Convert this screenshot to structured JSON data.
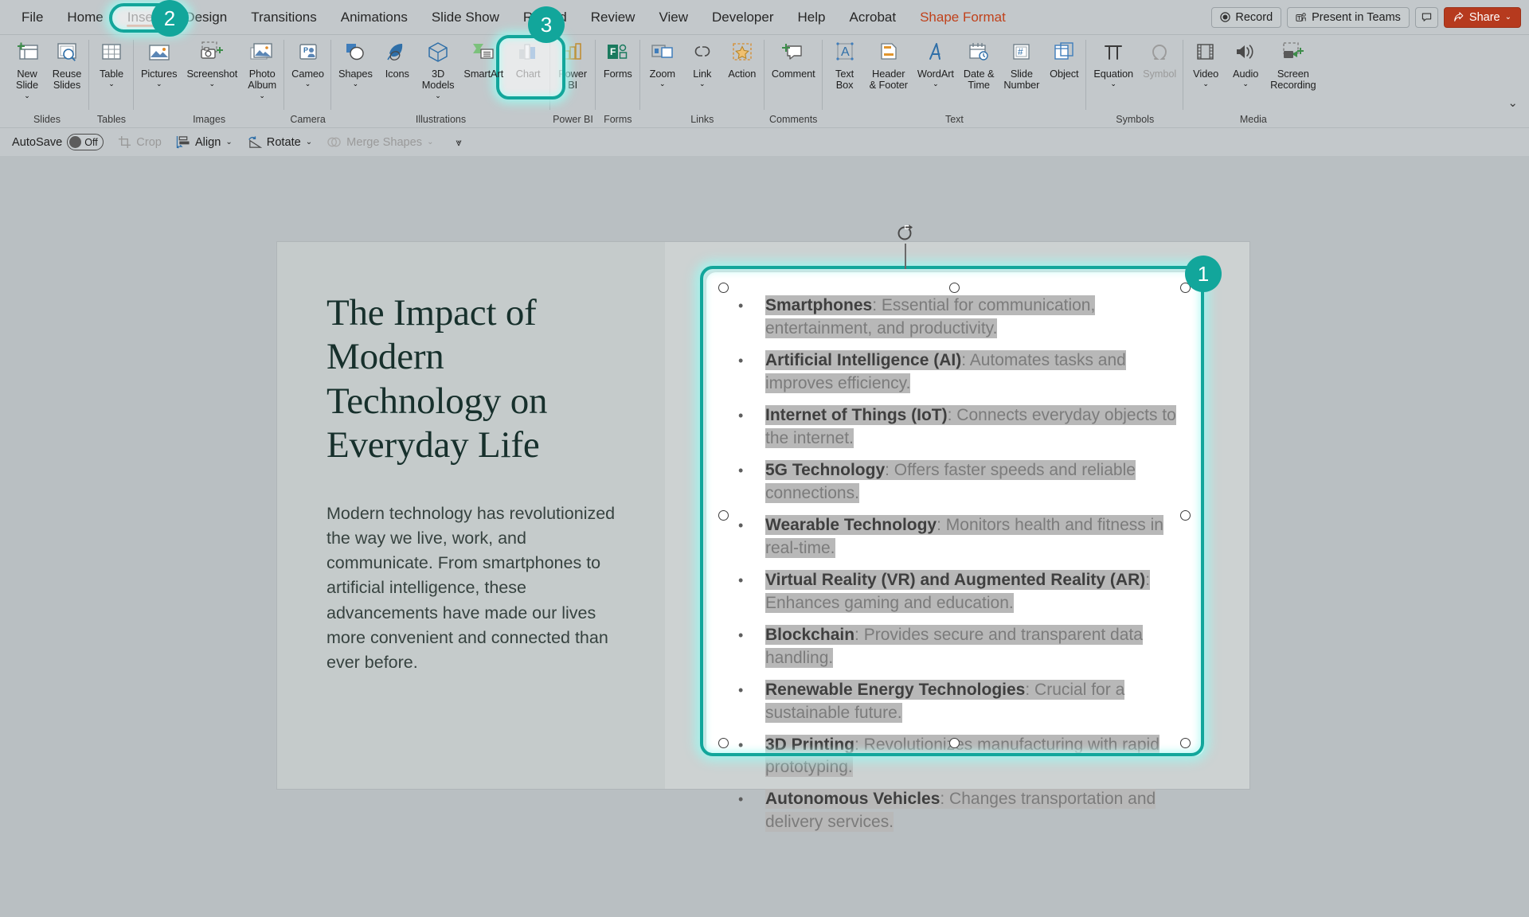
{
  "app": {
    "tabs": [
      {
        "id": "file",
        "label": "File"
      },
      {
        "id": "home",
        "label": "Home"
      },
      {
        "id": "insert",
        "label": "Insert",
        "active": true
      },
      {
        "id": "design",
        "label": "Design"
      },
      {
        "id": "transitions",
        "label": "Transitions"
      },
      {
        "id": "animations",
        "label": "Animations"
      },
      {
        "id": "slideshow",
        "label": "Slide Show"
      },
      {
        "id": "record",
        "label": "Record"
      },
      {
        "id": "review",
        "label": "Review"
      },
      {
        "id": "view",
        "label": "View"
      },
      {
        "id": "developer",
        "label": "Developer"
      },
      {
        "id": "help",
        "label": "Help"
      },
      {
        "id": "acrobat",
        "label": "Acrobat"
      },
      {
        "id": "shapeformat",
        "label": "Shape Format"
      }
    ],
    "titlebar_right": {
      "record": "Record",
      "present_in_teams": "Present in Teams",
      "comments_icon": "comment-icon",
      "share": "Share"
    }
  },
  "ribbon": {
    "groups": [
      {
        "name": "Slides",
        "label": "Slides",
        "buttons": [
          {
            "id": "new-slide",
            "label": "New\nSlide",
            "icon": "new-slide-icon",
            "caret": true
          },
          {
            "id": "reuse-slides",
            "label": "Reuse\nSlides",
            "icon": "reuse-slides-icon",
            "caret": false
          }
        ]
      },
      {
        "name": "Tables",
        "label": "Tables",
        "buttons": [
          {
            "id": "table",
            "label": "Table",
            "icon": "table-icon",
            "caret": true
          }
        ]
      },
      {
        "name": "Images",
        "label": "Images",
        "buttons": [
          {
            "id": "pictures",
            "label": "Pictures",
            "icon": "pictures-icon",
            "caret": true
          },
          {
            "id": "screenshot",
            "label": "Screenshot",
            "icon": "screenshot-icon",
            "caret": true
          },
          {
            "id": "photo-album",
            "label": "Photo\nAlbum",
            "icon": "photo-album-icon",
            "caret": true
          }
        ]
      },
      {
        "name": "Camera",
        "label": "Camera",
        "buttons": [
          {
            "id": "cameo",
            "label": "Cameo",
            "icon": "cameo-icon",
            "caret": true
          }
        ]
      },
      {
        "name": "Illustrations",
        "label": "Illustrations",
        "buttons": [
          {
            "id": "shapes",
            "label": "Shapes",
            "icon": "shapes-icon",
            "caret": true
          },
          {
            "id": "icons",
            "label": "Icons",
            "icon": "icons-icon",
            "caret": false
          },
          {
            "id": "3d-models",
            "label": "3D\nModels",
            "icon": "3d-models-icon",
            "caret": true
          },
          {
            "id": "smartart",
            "label": "SmartArt",
            "icon": "smartart-icon",
            "caret": false,
            "highlighted": true
          },
          {
            "id": "chart",
            "label": "Chart",
            "icon": "chart-icon",
            "caret": false
          }
        ]
      },
      {
        "name": "Power BI",
        "label": "Power BI",
        "buttons": [
          {
            "id": "power-bi",
            "label": "Power\nBI",
            "icon": "power-bi-icon",
            "caret": false
          }
        ]
      },
      {
        "name": "Forms",
        "label": "Forms",
        "buttons": [
          {
            "id": "forms",
            "label": "Forms",
            "icon": "forms-icon",
            "caret": false
          }
        ]
      },
      {
        "name": "Links",
        "label": "Links",
        "buttons": [
          {
            "id": "zoom",
            "label": "Zoom",
            "icon": "zoom-icon",
            "caret": true
          },
          {
            "id": "link",
            "label": "Link",
            "icon": "link-icon",
            "caret": true
          },
          {
            "id": "action",
            "label": "Action",
            "icon": "action-icon",
            "caret": false
          }
        ]
      },
      {
        "name": "Comments",
        "label": "Comments",
        "buttons": [
          {
            "id": "comment",
            "label": "Comment",
            "icon": "comment-new-icon",
            "caret": false
          }
        ]
      },
      {
        "name": "Text",
        "label": "Text",
        "buttons": [
          {
            "id": "text-box",
            "label": "Text\nBox",
            "icon": "text-box-icon",
            "caret": false
          },
          {
            "id": "header-footer",
            "label": "Header\n& Footer",
            "icon": "header-footer-icon",
            "caret": false
          },
          {
            "id": "wordart",
            "label": "WordArt",
            "icon": "wordart-icon",
            "caret": true
          },
          {
            "id": "date-time",
            "label": "Date &\nTime",
            "icon": "date-time-icon",
            "caret": false
          },
          {
            "id": "slide-number",
            "label": "Slide\nNumber",
            "icon": "slide-number-icon",
            "caret": false
          },
          {
            "id": "object",
            "label": "Object",
            "icon": "object-icon",
            "caret": false
          }
        ]
      },
      {
        "name": "Symbols",
        "label": "Symbols",
        "buttons": [
          {
            "id": "equation",
            "label": "Equation",
            "icon": "equation-icon",
            "caret": true
          },
          {
            "id": "symbol",
            "label": "Symbol",
            "icon": "symbol-icon",
            "caret": false,
            "disabled": true
          }
        ]
      },
      {
        "name": "Media",
        "label": "Media",
        "buttons": [
          {
            "id": "video",
            "label": "Video",
            "icon": "video-icon",
            "caret": true
          },
          {
            "id": "audio",
            "label": "Audio",
            "icon": "audio-icon",
            "caret": true
          },
          {
            "id": "screen-recording",
            "label": "Screen\nRecording",
            "icon": "screen-recording-icon",
            "caret": false
          }
        ]
      }
    ],
    "collapse_icon": "chevron-down-icon"
  },
  "toolbar2": {
    "autosave_label": "AutoSave",
    "autosave_state": "Off",
    "items": [
      {
        "id": "crop",
        "label": "Crop",
        "icon": "crop-icon",
        "disabled": true,
        "caret": false
      },
      {
        "id": "align",
        "label": "Align",
        "icon": "align-icon",
        "disabled": false,
        "caret": true
      },
      {
        "id": "rotate",
        "label": "Rotate",
        "icon": "rotate-icon",
        "disabled": false,
        "caret": true
      },
      {
        "id": "merge-shapes",
        "label": "Merge Shapes",
        "icon": "merge-shapes-icon",
        "disabled": true,
        "caret": true
      }
    ],
    "overflow_icon": "more-commands-icon"
  },
  "slide": {
    "title": "The Impact of Modern Technology on Everyday Life",
    "body": "Modern technology has revolutionized the way we live, work, and communicate. From smartphones to artificial intelligence, these advancements have made our lives more convenient and connected than ever before.",
    "bullets": [
      {
        "term": "Smartphones",
        "rest": ": Essential for communication, entertainment, and productivity."
      },
      {
        "term": "Artificial Intelligence (AI)",
        "rest": ": Automates tasks and improves efficiency."
      },
      {
        "term": "Internet of Things (IoT)",
        "rest": ": Connects everyday objects to the internet."
      },
      {
        "term": "5G Technology",
        "rest": ": Offers faster speeds and reliable connections."
      },
      {
        "term": "Wearable Technology",
        "rest": ": Monitors health and fitness in real-time."
      },
      {
        "term": "Virtual Reality (VR) and Augmented Reality (AR)",
        "rest": ": Enhances gaming and education."
      },
      {
        "term": "Blockchain",
        "rest": ": Provides secure and transparent data handling."
      },
      {
        "term": "Renewable Energy Technologies",
        "rest": ": Crucial for a sustainable future."
      },
      {
        "term": "3D Printing",
        "rest": ": Revolutionizes manufacturing with rapid prototyping."
      },
      {
        "term": "Autonomous Vehicles",
        "rest": ": Changes transportation and delivery services."
      }
    ]
  },
  "callouts": {
    "step1": "1",
    "step2": "2",
    "step3": "3"
  },
  "colors": {
    "accent_teal": "#12a69b",
    "share_red": "#b63a1e",
    "tab_underline": "#c0421c",
    "slide_title": "#17302c",
    "highlight_gray": "#b8b8b8"
  }
}
